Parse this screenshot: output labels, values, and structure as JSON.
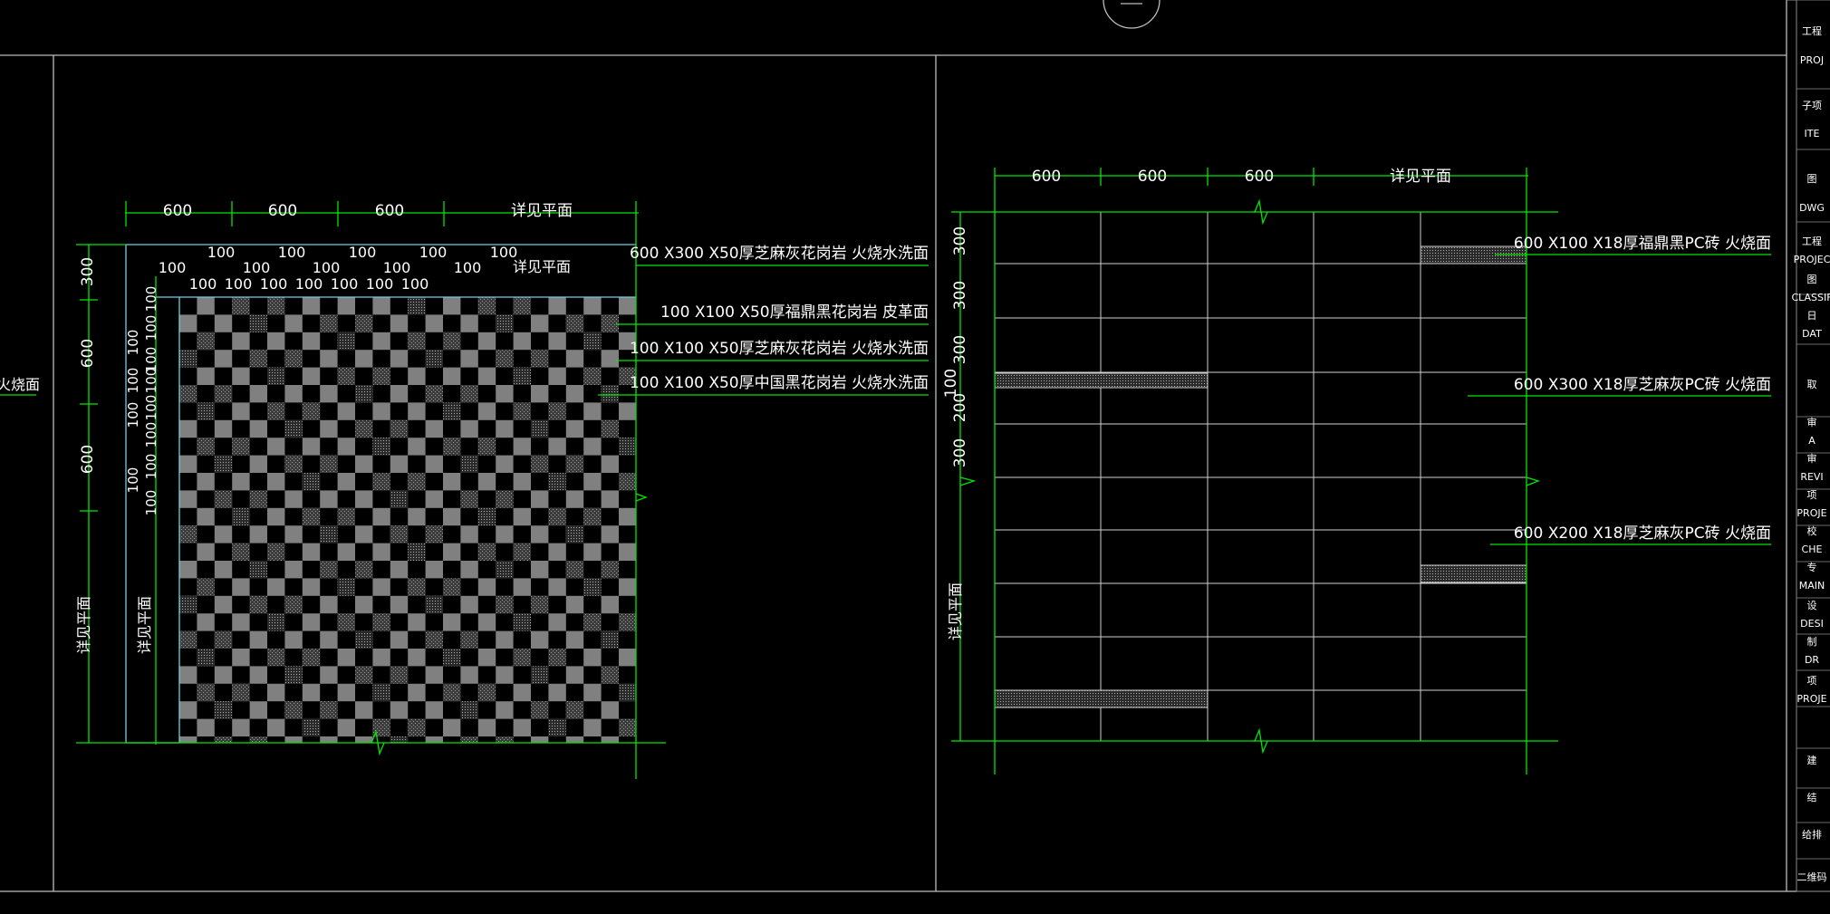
{
  "colors": {
    "background": "#000000",
    "dim_line": "#00ff00",
    "frame_line": "#c8c8c8",
    "text": "#ffffff",
    "tile_light": "#808080",
    "tile_dark": "#000000",
    "tile_mid": "#5a5a5a"
  },
  "left_elevation": {
    "top_dims": [
      "600",
      "600",
      "600",
      "详见平面"
    ],
    "second_dims": [
      "100",
      "100",
      "100",
      "100",
      "100"
    ],
    "third_dims": [
      "100",
      "100",
      "100",
      "100",
      "100"
    ],
    "fourth_dims": [
      "100",
      "100",
      "100",
      "100",
      "100",
      "100",
      "100"
    ],
    "second_row_note": "详见平面",
    "left_dims": [
      "300",
      "600",
      "600"
    ],
    "left_bottom_note": "详见平面",
    "inner_dims": [
      "100",
      "100",
      "100",
      "100"
    ],
    "inner2_dims": [
      "100",
      "100",
      "100",
      "100",
      "100",
      "100",
      "100",
      "100"
    ],
    "inner_bottom_note": "详见平面",
    "far_left_label": "火烧面",
    "callouts": [
      "600 X300 X50厚芝麻灰花岗岩 火烧水洗面",
      "100 X100 X50厚福鼎黑花岗岩 皮革面",
      "100 X100 X50厚芝麻灰花岗岩 火烧水洗面",
      "100 X100 X50厚中国黑花岗岩 火烧水洗面"
    ]
  },
  "right_elevation": {
    "top_dims": [
      "600",
      "600",
      "600",
      "详见平面"
    ],
    "left_dims": [
      "300",
      "300",
      "300",
      "100",
      "200",
      "300"
    ],
    "left_bottom_note": "详见平面",
    "callouts": [
      "600 X100 X18厚福鼎黑PC砖 火烧面",
      "600 X300 X18厚芝麻灰PC砖 火烧面",
      "600 X200 X18厚芝麻灰PC砖 火烧面"
    ]
  },
  "title_block": {
    "rows": [
      "工程",
      "PROJ",
      "子项",
      "ITE",
      "图",
      "DWG",
      "工程",
      "PROJEC",
      "图",
      "CLASSIF",
      "日",
      "DAT",
      "取",
      "审",
      "A",
      "审",
      "REVI",
      "项",
      "PROJE",
      "校",
      "CHE",
      "专",
      "MAIN",
      "设",
      "DESI",
      "制",
      "DR",
      "项",
      "PROJE",
      "建",
      "结",
      "给排",
      "二维码"
    ]
  }
}
